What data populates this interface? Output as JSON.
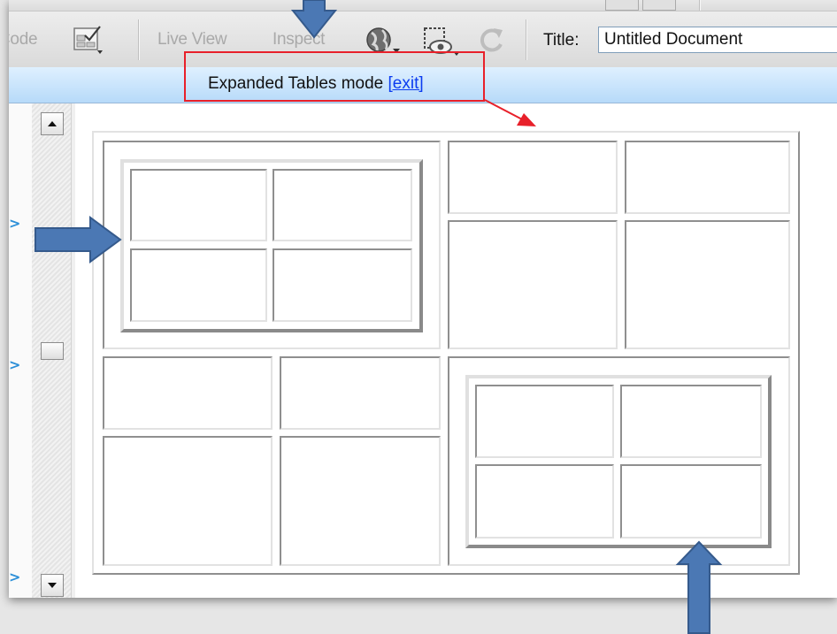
{
  "toolbar": {
    "code_label": "Code",
    "live_view_label": "Live View",
    "inspect_label": "Inspect",
    "title_label": "Title:",
    "title_value": "Untitled Document"
  },
  "mode_bar": {
    "text": "Expanded Tables mode",
    "exit_label": "[exit]"
  },
  "gutter": {
    "caret_symbol": ">"
  },
  "icons": {
    "validate": "validate-icon",
    "browser": "globe-preview-icon",
    "visual_aids": "visual-aids-icon",
    "refresh": "refresh-icon",
    "scroll_up": "scroll-up-arrow-icon",
    "scroll_down": "scroll-down-arrow-icon"
  },
  "colors": {
    "annotation_arrow": "#4b78b4",
    "annotation_highlight": "#e8202a",
    "link": "#0b3cf0",
    "mode_bar": "#c7e4ff"
  }
}
